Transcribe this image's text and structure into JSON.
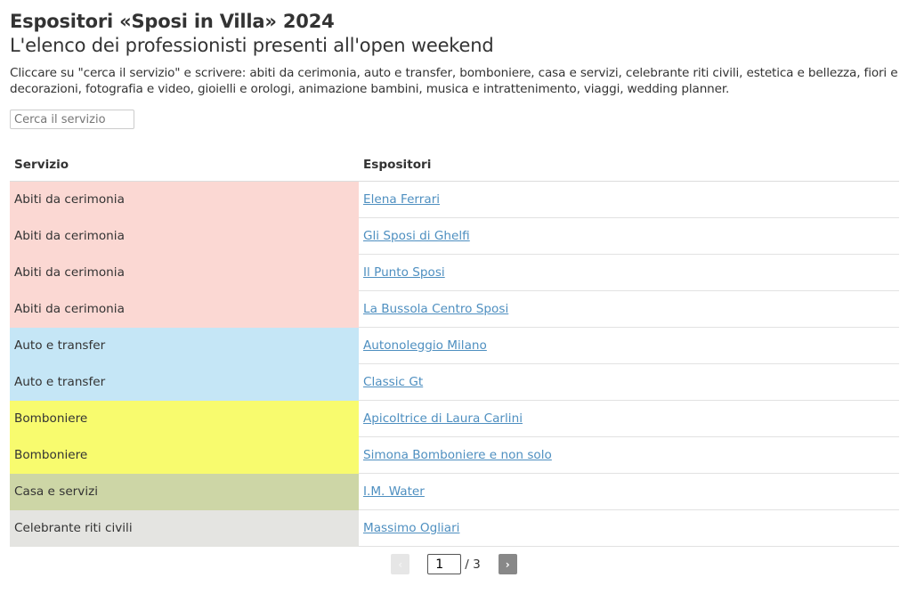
{
  "header": {
    "title": "Espositori «Sposi in Villa» 2024",
    "subtitle": "L'elenco dei professionisti presenti all'open weekend",
    "description": "Cliccare su \"cerca il servizio\" e scrivere: abiti da cerimonia, auto e transfer, bomboniere, casa e servizi, celebrante riti civili, estetica e bellezza, fiori e decorazioni, fotografia e video, gioielli e orologi, animazione bambini, musica e intrattenimento, viaggi, wedding planner."
  },
  "search": {
    "placeholder": "Cerca il servizio",
    "value": ""
  },
  "table": {
    "columns": [
      "Servizio",
      "Espositori"
    ],
    "rows": [
      {
        "servizio": "Abiti da cerimonia",
        "espositore": "Elena Ferrari",
        "color": "#fbd8d3"
      },
      {
        "servizio": "Abiti da cerimonia",
        "espositore": "Gli Sposi di Ghelfi",
        "color": "#fbd8d3"
      },
      {
        "servizio": "Abiti da cerimonia",
        "espositore": "Il Punto Sposi",
        "color": "#fbd8d3"
      },
      {
        "servizio": "Abiti da cerimonia",
        "espositore": "La Bussola Centro Sposi",
        "color": "#fbd8d3"
      },
      {
        "servizio": "Auto e transfer",
        "espositore": "Autonoleggio Milano",
        "color": "#c5e6f6"
      },
      {
        "servizio": "Auto e transfer",
        "espositore": "Classic Gt",
        "color": "#c5e6f6"
      },
      {
        "servizio": "Bomboniere",
        "espositore": "Apicoltrice di Laura Carlini",
        "color": "#f8fb6e"
      },
      {
        "servizio": "Bomboniere",
        "espositore": "Simona Bomboniere e non solo",
        "color": "#f8fb6e"
      },
      {
        "servizio": "Casa e servizi",
        "espositore": "I.M. Water",
        "color": "#cdd6a6"
      },
      {
        "servizio": "Celebrante riti civili",
        "espositore": "Massimo Ogliari",
        "color": "#e4e4e1"
      }
    ]
  },
  "pagination": {
    "prev_icon": "‹",
    "next_icon": "›",
    "current_page": "1",
    "total_label": "/ 3"
  }
}
